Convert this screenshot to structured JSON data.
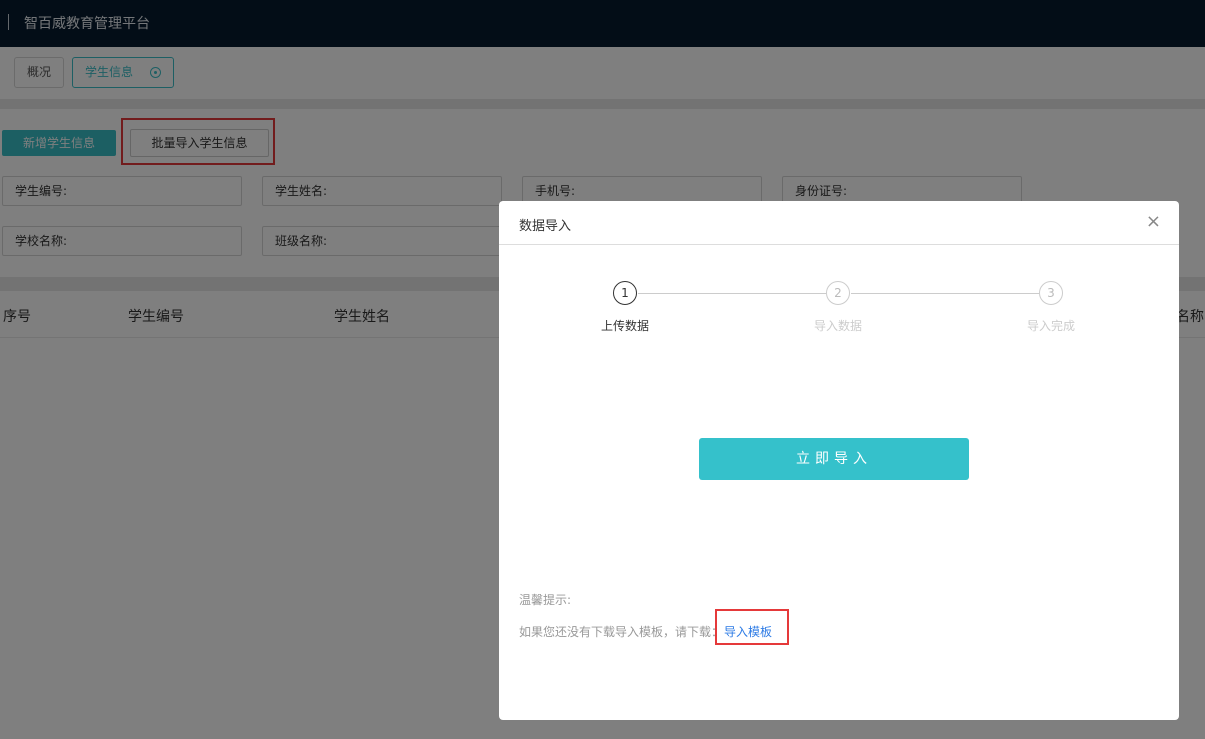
{
  "app": {
    "title": "智百威教育管理平台"
  },
  "tabs": {
    "overview": "概况",
    "student": "学生信息"
  },
  "toolbar": {
    "add_label": "新增学生信息",
    "batch_label": "批量导入学生信息"
  },
  "filters": {
    "student_no": "学生编号:",
    "student_name": "学生姓名:",
    "phone": "手机号:",
    "id_card": "身份证号:",
    "school_name": "学校名称:",
    "class_name": "班级名称:"
  },
  "table": {
    "columns": [
      "序号",
      "学生编号",
      "学生姓名",
      "名称"
    ]
  },
  "modal": {
    "title": "数据导入",
    "close": "×",
    "steps": [
      {
        "num": "1",
        "label": "上传数据"
      },
      {
        "num": "2",
        "label": "导入数据"
      },
      {
        "num": "3",
        "label": "导入完成"
      }
    ],
    "import_label": "立即导入",
    "tip_title": "温馨提示:",
    "tip_text": "如果您还没有下载导入模板，请下载：",
    "template_link": "导入模板"
  },
  "colors": {
    "accent": "#38bec7",
    "header": "#061b2e",
    "highlight": "#e5393a",
    "link": "#2d7be5"
  }
}
